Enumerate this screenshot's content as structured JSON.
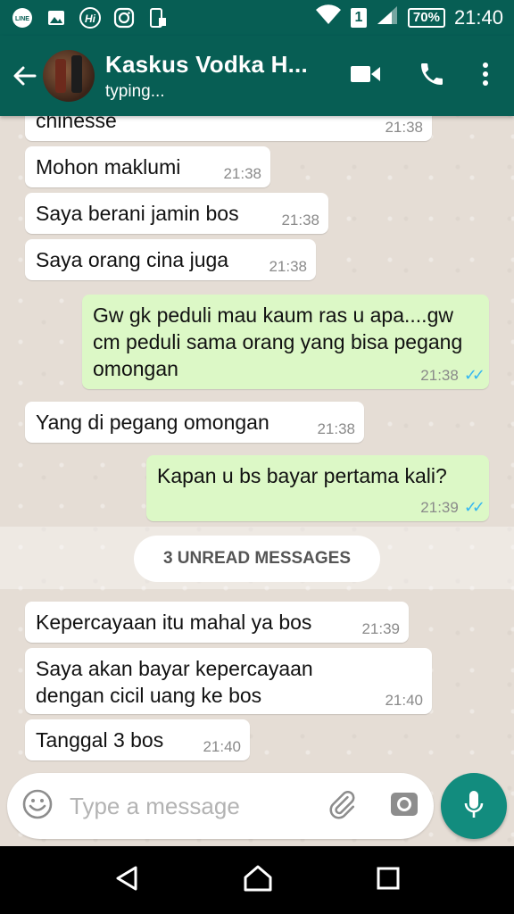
{
  "status_bar": {
    "time": "21:40",
    "battery": "70%",
    "sim": "1",
    "icons": [
      "line-icon",
      "gallery-icon",
      "hi-icon",
      "instagram-icon",
      "phone-signal-icon",
      "wifi-icon",
      "cell-signal-icon"
    ]
  },
  "header": {
    "contact_name": "Kaskus Vodka H...",
    "status": "typing...",
    "icons": [
      "back-arrow-icon",
      "video-call-icon",
      "voice-call-icon",
      "more-vert-icon"
    ]
  },
  "messages": [
    {
      "dir": "in",
      "text": "chinesse",
      "time": "21:38"
    },
    {
      "dir": "in",
      "text": "Mohon maklumi",
      "time": "21:38"
    },
    {
      "dir": "in",
      "text": "Saya berani jamin bos",
      "time": "21:38"
    },
    {
      "dir": "in",
      "text": "Saya orang cina juga",
      "time": "21:38"
    },
    {
      "dir": "out",
      "text": "Gw gk peduli mau kaum ras u apa....gw cm peduli sama orang yang bisa pegang omongan",
      "time": "21:38",
      "ticks": "✓✓"
    },
    {
      "dir": "in",
      "text": "Yang di pegang omongan",
      "time": "21:38"
    },
    {
      "dir": "out",
      "text": "Kapan u bs bayar pertama kali?",
      "time": "21:39",
      "ticks": "✓✓"
    },
    {
      "dir": "in",
      "text": "Kepercayaan itu mahal ya bos",
      "time": "21:39"
    },
    {
      "dir": "in",
      "text": "Saya akan bayar kepercayaan dengan cicil uang ke bos",
      "time": "21:40"
    },
    {
      "dir": "in",
      "text": "Tanggal 3 bos",
      "time": "21:40"
    }
  ],
  "unread_label": "3 UNREAD MESSAGES",
  "composer": {
    "placeholder": "Type a message"
  },
  "colors": {
    "header": "#075e54",
    "outgoing": "#dcf8c6",
    "incoming": "#ffffff",
    "fab": "#128c7e",
    "read_ticks": "#34b7f1"
  }
}
